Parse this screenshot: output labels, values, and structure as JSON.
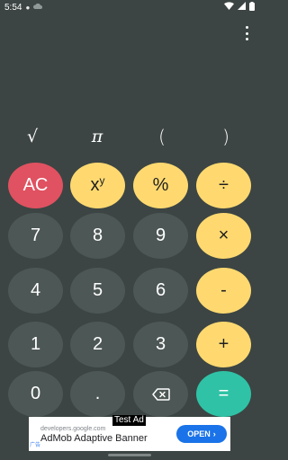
{
  "status_bar": {
    "time": "5:54",
    "left_icons": [
      "chat-bubble-icon",
      "cloud-icon"
    ],
    "right_icons": [
      "wifi-icon",
      "signal-icon",
      "battery-icon"
    ]
  },
  "menu": {
    "icon": "more-vert-icon"
  },
  "scientific_keys": [
    "√",
    "π",
    "(",
    ")"
  ],
  "keys": {
    "ac": "AC",
    "power_base": "x",
    "power_exp": "y",
    "percent": "%",
    "divide": "÷",
    "seven": "7",
    "eight": "8",
    "nine": "9",
    "multiply": "×",
    "four": "4",
    "five": "5",
    "six": "6",
    "subtract": "-",
    "one": "1",
    "two": "2",
    "three": "3",
    "add": "+",
    "zero": "0",
    "decimal": ".",
    "backspace": "backspace-icon",
    "equals": "="
  },
  "ad": {
    "label": "Test Ad",
    "domain": "developers.google.com",
    "title": "AdMob Adaptive Banner",
    "badge": "广告",
    "cta": "OPEN"
  },
  "colors": {
    "background": "#3c4543",
    "number_key": "#4d5755",
    "clear_key": "#e05261",
    "operator_key": "#ffd970",
    "equals_key": "#2fc2a6",
    "ad_button": "#1a73e8"
  }
}
